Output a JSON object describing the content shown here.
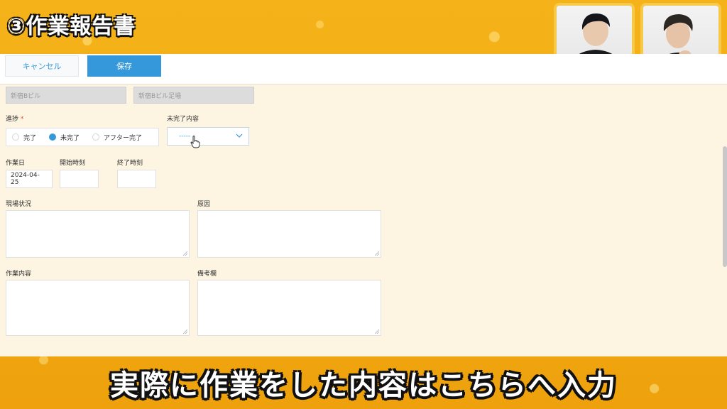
{
  "overlay": {
    "title": "③作業報告書",
    "caption": "実際に作業をした内容はこちらへ入力"
  },
  "toolbar": {
    "cancel_label": "キャンセル",
    "save_label": "保存"
  },
  "form": {
    "site_name": "新宿Bビル",
    "site_detail": "新宿Bビル足場",
    "progress": {
      "label": "進捗",
      "required_mark": "*",
      "options": [
        "完了",
        "未完了",
        "アフター完了"
      ],
      "selected": "未完了"
    },
    "incomplete": {
      "label": "未完了内容",
      "value": "-----"
    },
    "work_date": {
      "label": "作業日",
      "value": "2024-04-25"
    },
    "start_time": {
      "label": "開始時刻",
      "value": ""
    },
    "end_time": {
      "label": "終了時刻",
      "value": ""
    },
    "site_status": {
      "label": "現場状況"
    },
    "cause": {
      "label": "原因"
    },
    "work_content": {
      "label": "作業内容"
    },
    "remarks": {
      "label": "備考欄"
    }
  },
  "colors": {
    "accent": "#3498db",
    "frame": "#f2a814",
    "form_bg": "#fdf5e2",
    "required": "#e74c3c"
  },
  "icons": {
    "select": "chevron-down-icon",
    "pointer": "hand-pointer-icon"
  }
}
